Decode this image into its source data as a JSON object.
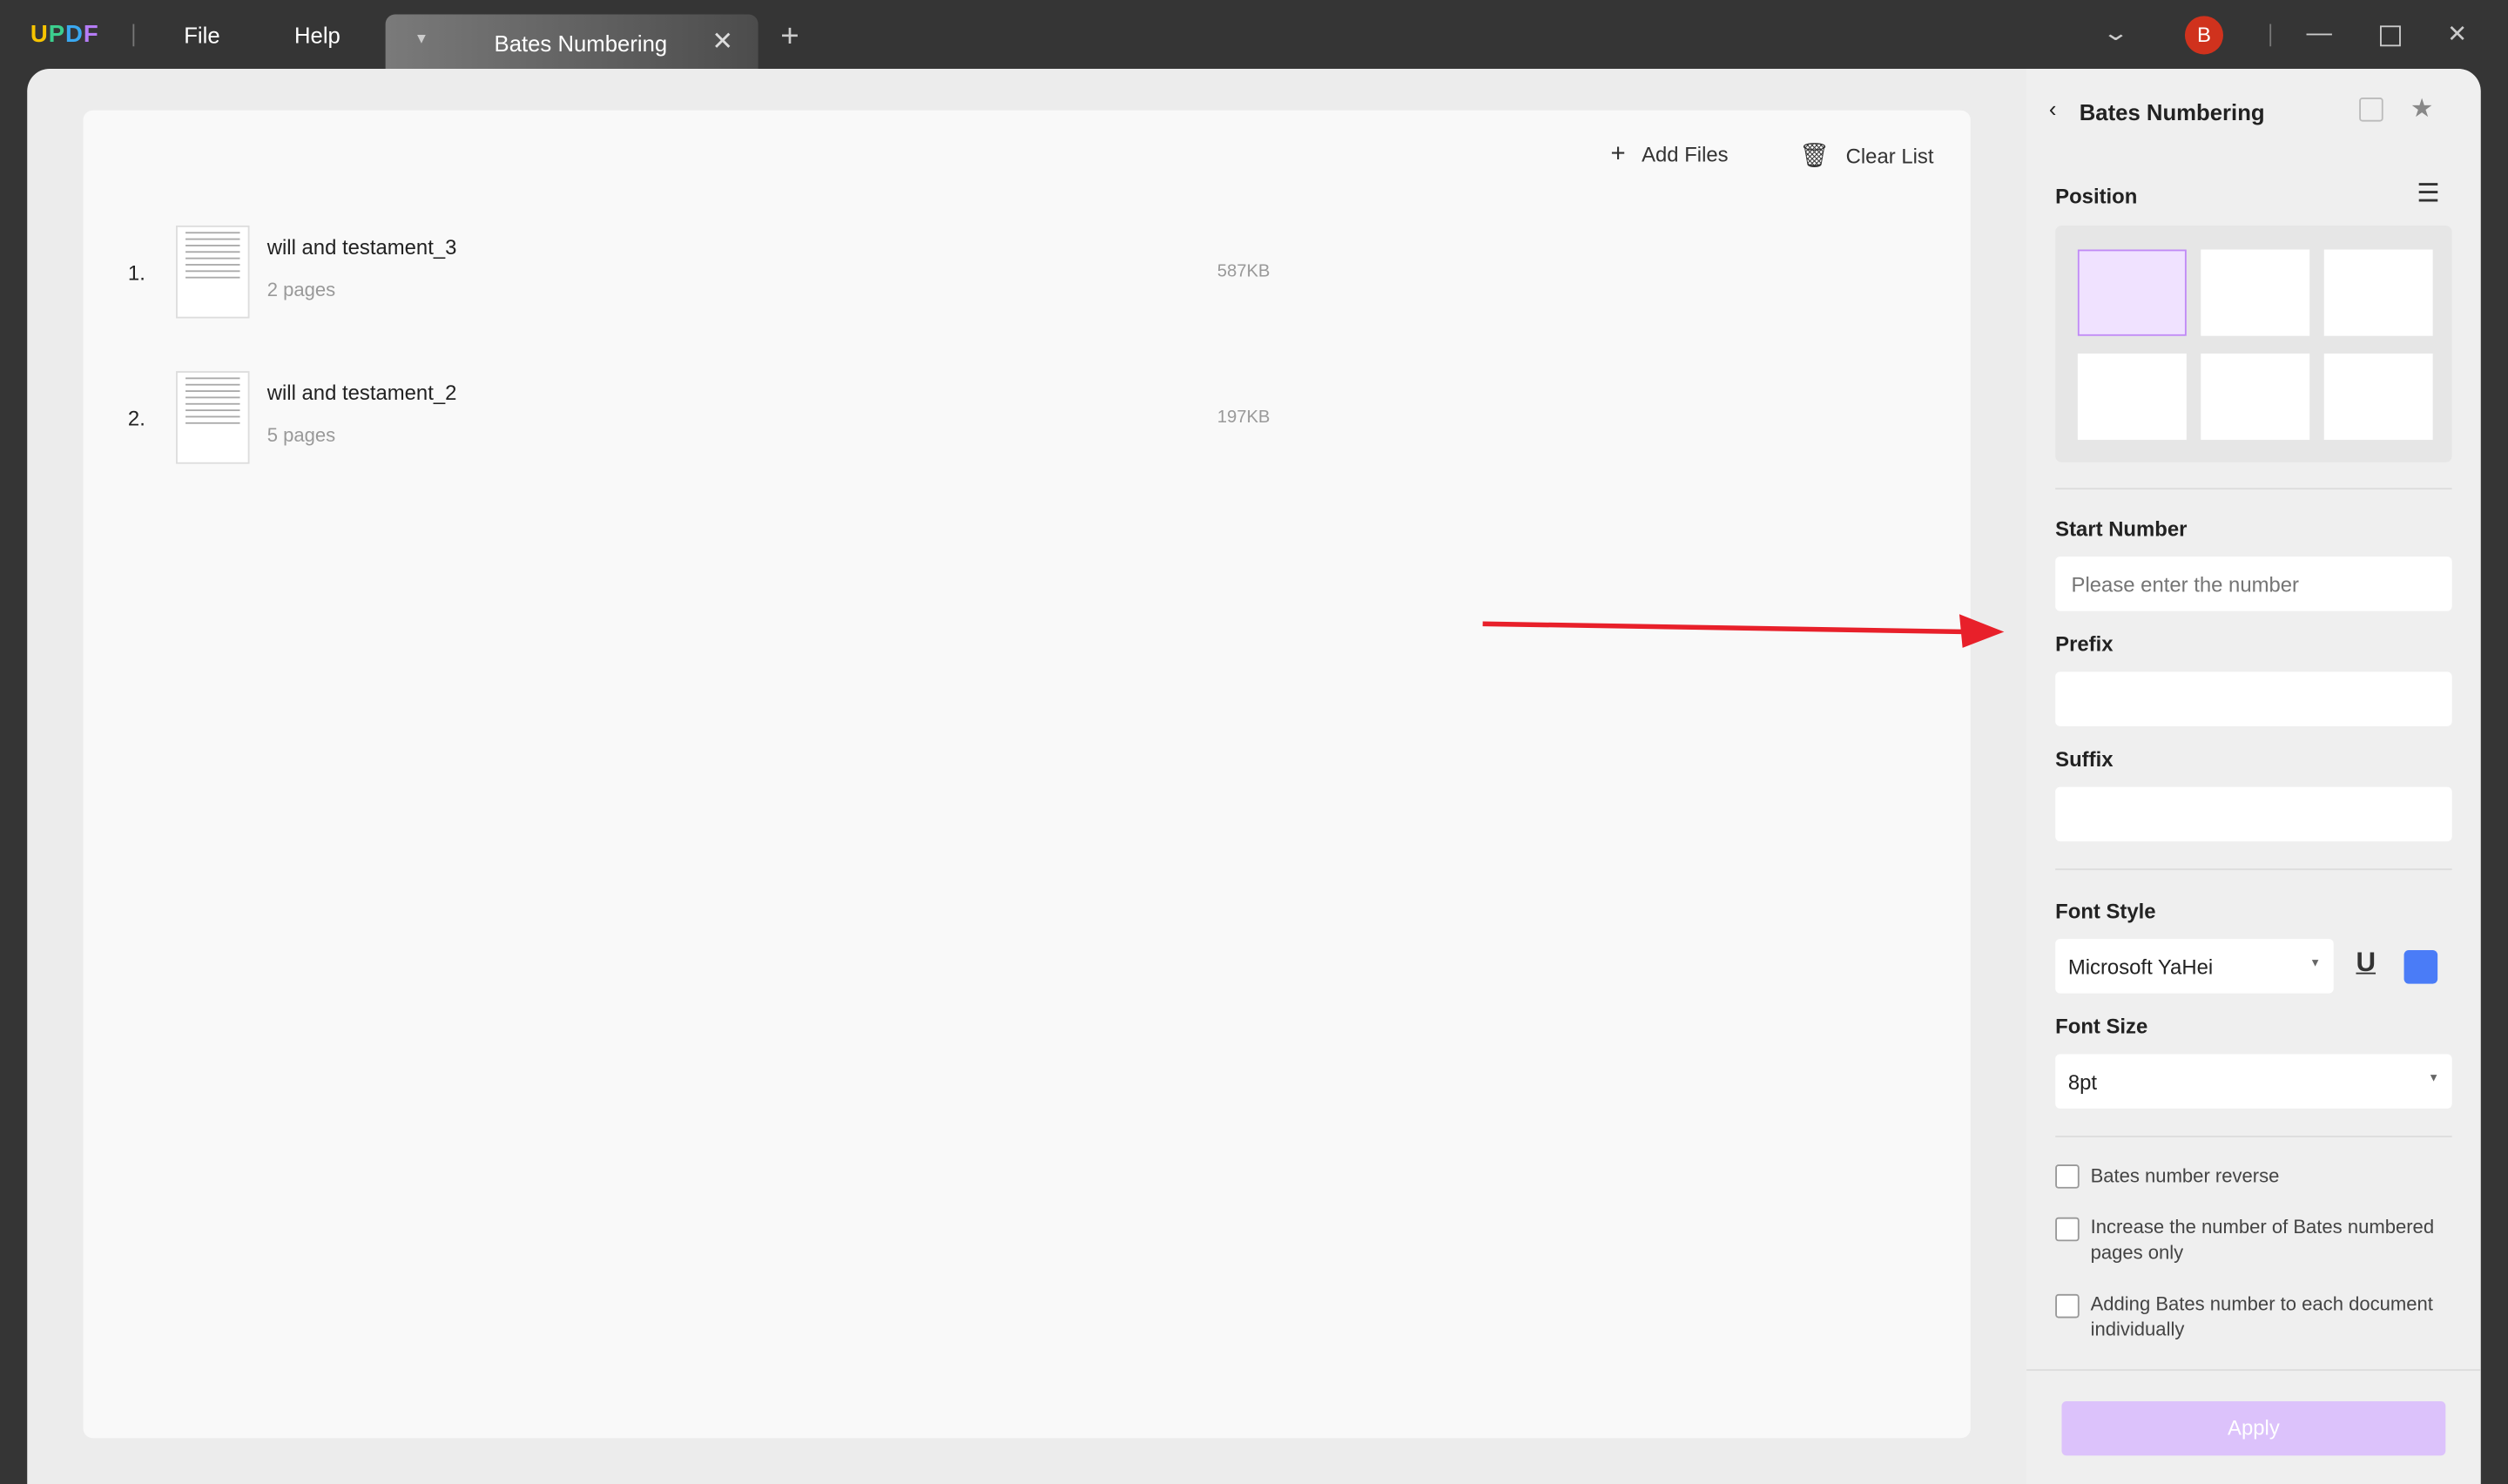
{
  "app": {
    "logo": "UPDF",
    "menu": [
      "File",
      "Help"
    ],
    "tab_title": "Bates Numbering",
    "avatar_initial": "B"
  },
  "toolbar": {
    "add_files": "Add Files",
    "clear_list": "Clear List"
  },
  "files": [
    {
      "index": "1.",
      "name": "will and testament_3",
      "pages": "2 pages",
      "size": "587KB"
    },
    {
      "index": "2.",
      "name": "will and testament_2",
      "pages": "5 pages",
      "size": "197KB"
    }
  ],
  "panel": {
    "title": "Bates Numbering",
    "position_label": "Position",
    "start_number_label": "Start Number",
    "start_number_placeholder": "Please enter the number",
    "prefix_label": "Prefix",
    "suffix_label": "Suffix",
    "font_style_label": "Font Style",
    "font_value": "Microsoft YaHei",
    "font_size_label": "Font Size",
    "font_size_value": "8pt",
    "font_color": "#4a7cf7",
    "checkboxes": [
      "Bates number reverse",
      "Increase the number of Bates numbered pages only",
      "Adding Bates number to each document individually"
    ],
    "apply": "Apply"
  }
}
